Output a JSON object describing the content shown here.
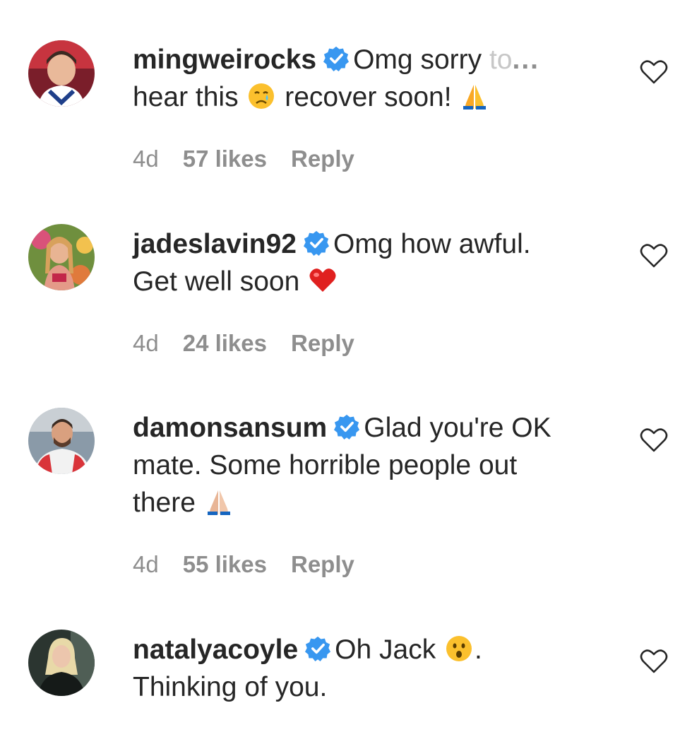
{
  "comments": [
    {
      "username": "mingweirocks",
      "text_1": "Omg sorry ",
      "text_faded": "to",
      "more": "...",
      "text_2": "hear this ",
      "text_3": " recover soon! ",
      "time": "4d",
      "likes": "57 likes",
      "reply": "Reply",
      "emojis": [
        "crying-face",
        "folded-hands"
      ]
    },
    {
      "username": "jadeslavin92",
      "text_1": "Omg how awful.",
      "text_2": "Get well soon ",
      "time": "4d",
      "likes": "24 likes",
      "reply": "Reply",
      "emojis": [
        "red-heart"
      ]
    },
    {
      "username": "damonsansum",
      "text_1": "Glad you're OK",
      "text_2": "mate. Some horrible people out",
      "text_3": "there ",
      "time": "4d",
      "likes": "55 likes",
      "reply": "Reply",
      "emojis": [
        "folded-hands-light"
      ]
    },
    {
      "username": "natalyacoyle",
      "text_1": "Oh Jack ",
      "text_1b": ".",
      "text_2": "Thinking of you.",
      "emojis": [
        "surprised-face"
      ]
    }
  ],
  "icons": {
    "verified": "verified-badge-icon",
    "like": "heart-outline-icon"
  },
  "colors": {
    "verified": "#3897f0",
    "meta_text": "#8e8e8e",
    "primary_text": "#262626"
  }
}
